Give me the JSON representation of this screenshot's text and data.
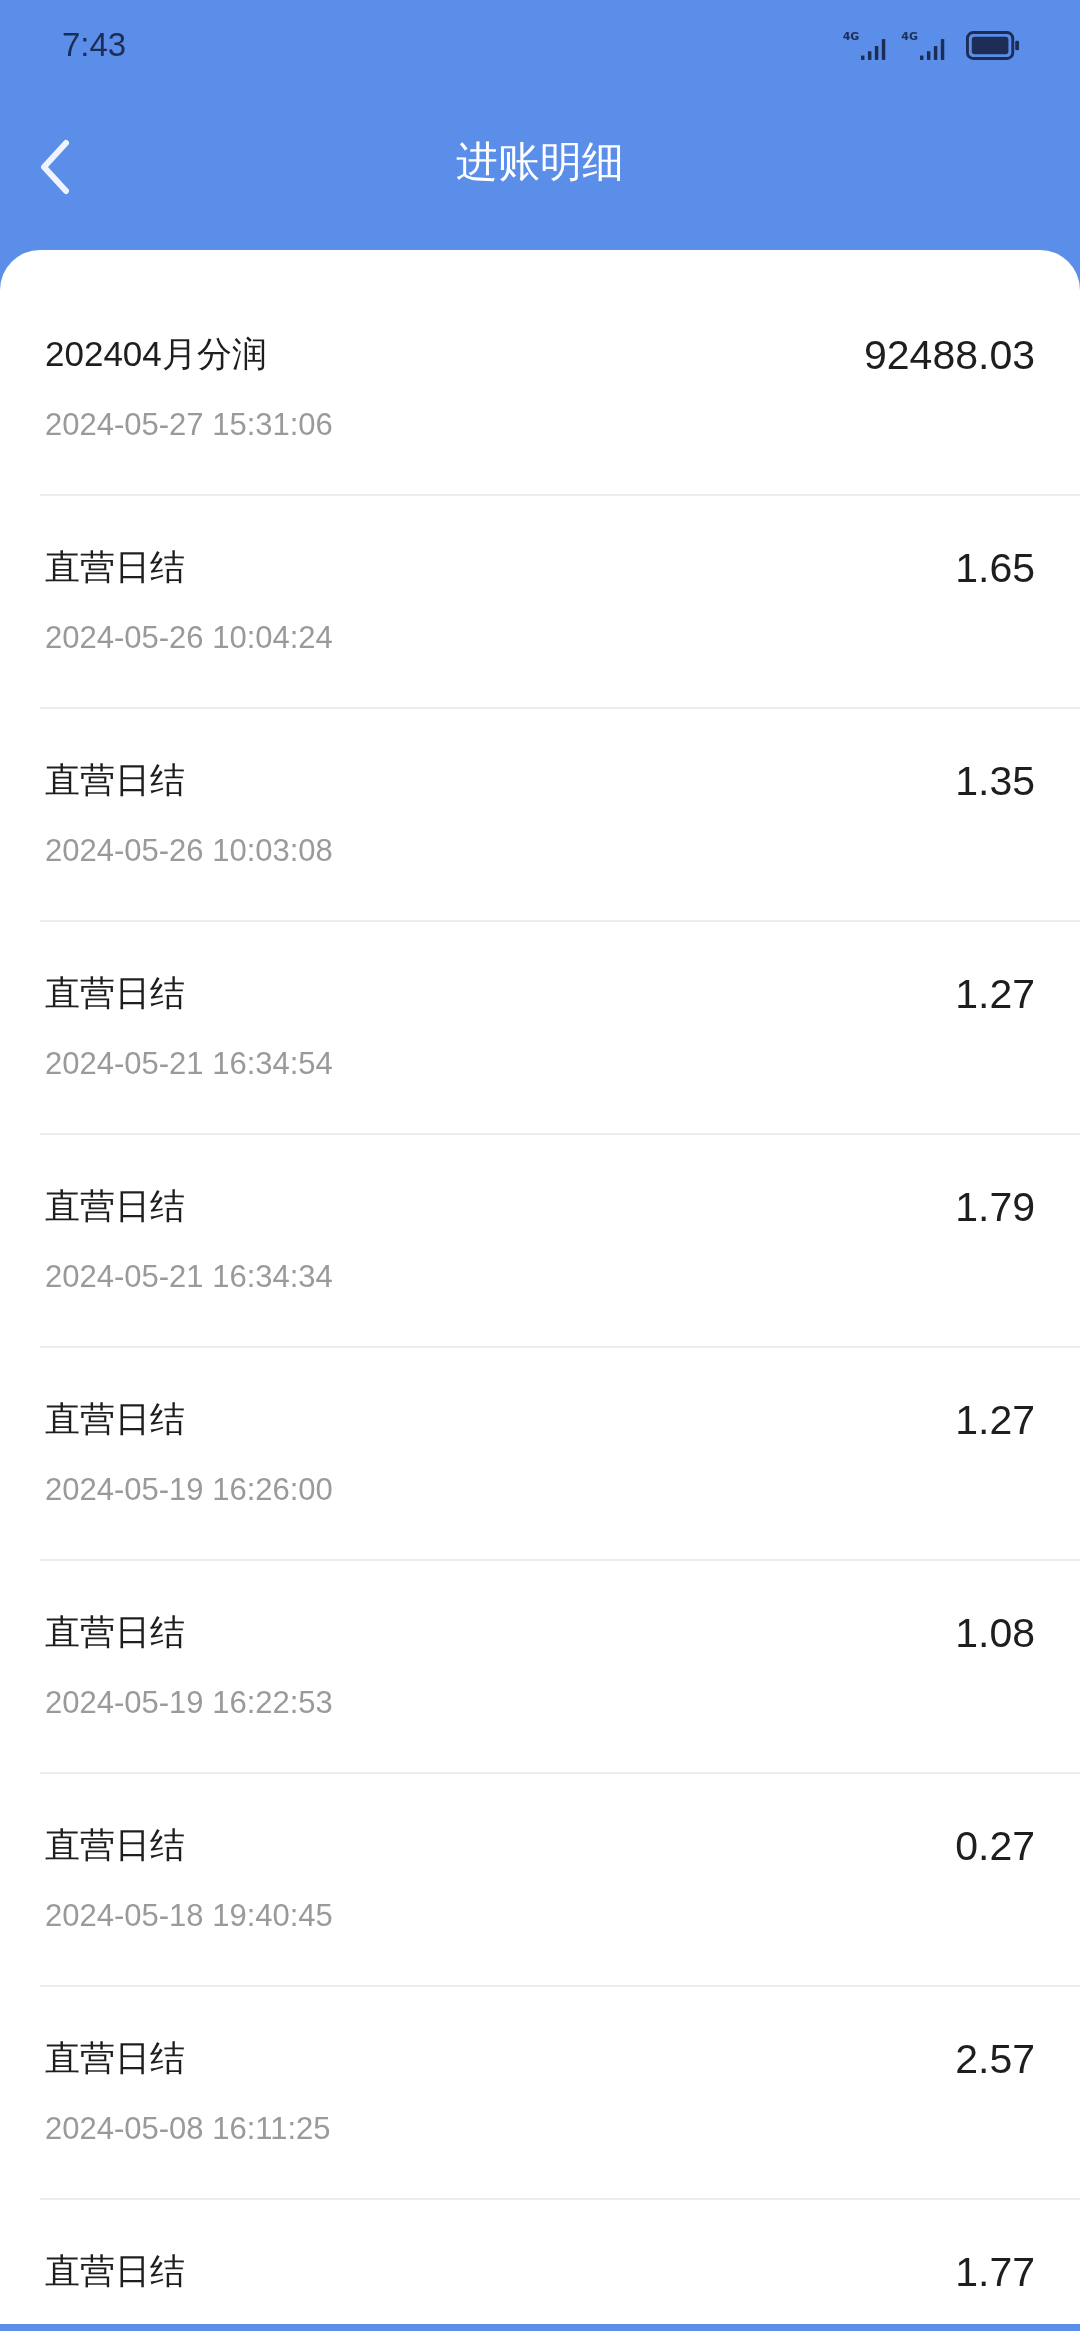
{
  "status_bar": {
    "time": "7:43",
    "networks": [
      "4G",
      "4G"
    ]
  },
  "header": {
    "title": "进账明细"
  },
  "entries": [
    {
      "title": "202404月分润",
      "time": "2024-05-27 15:31:06",
      "amount": "92488.03"
    },
    {
      "title": "直营日结",
      "time": "2024-05-26 10:04:24",
      "amount": "1.65"
    },
    {
      "title": "直营日结",
      "time": "2024-05-26 10:03:08",
      "amount": "1.35"
    },
    {
      "title": "直营日结",
      "time": "2024-05-21 16:34:54",
      "amount": "1.27"
    },
    {
      "title": "直营日结",
      "time": "2024-05-21 16:34:34",
      "amount": "1.79"
    },
    {
      "title": "直营日结",
      "time": "2024-05-19 16:26:00",
      "amount": "1.27"
    },
    {
      "title": "直营日结",
      "time": "2024-05-19 16:22:53",
      "amount": "1.08"
    },
    {
      "title": "直营日结",
      "time": "2024-05-18 19:40:45",
      "amount": "0.27"
    },
    {
      "title": "直营日结",
      "time": "2024-05-08 16:11:25",
      "amount": "2.57"
    },
    {
      "title": "直营日结",
      "amount": "1.77"
    }
  ]
}
